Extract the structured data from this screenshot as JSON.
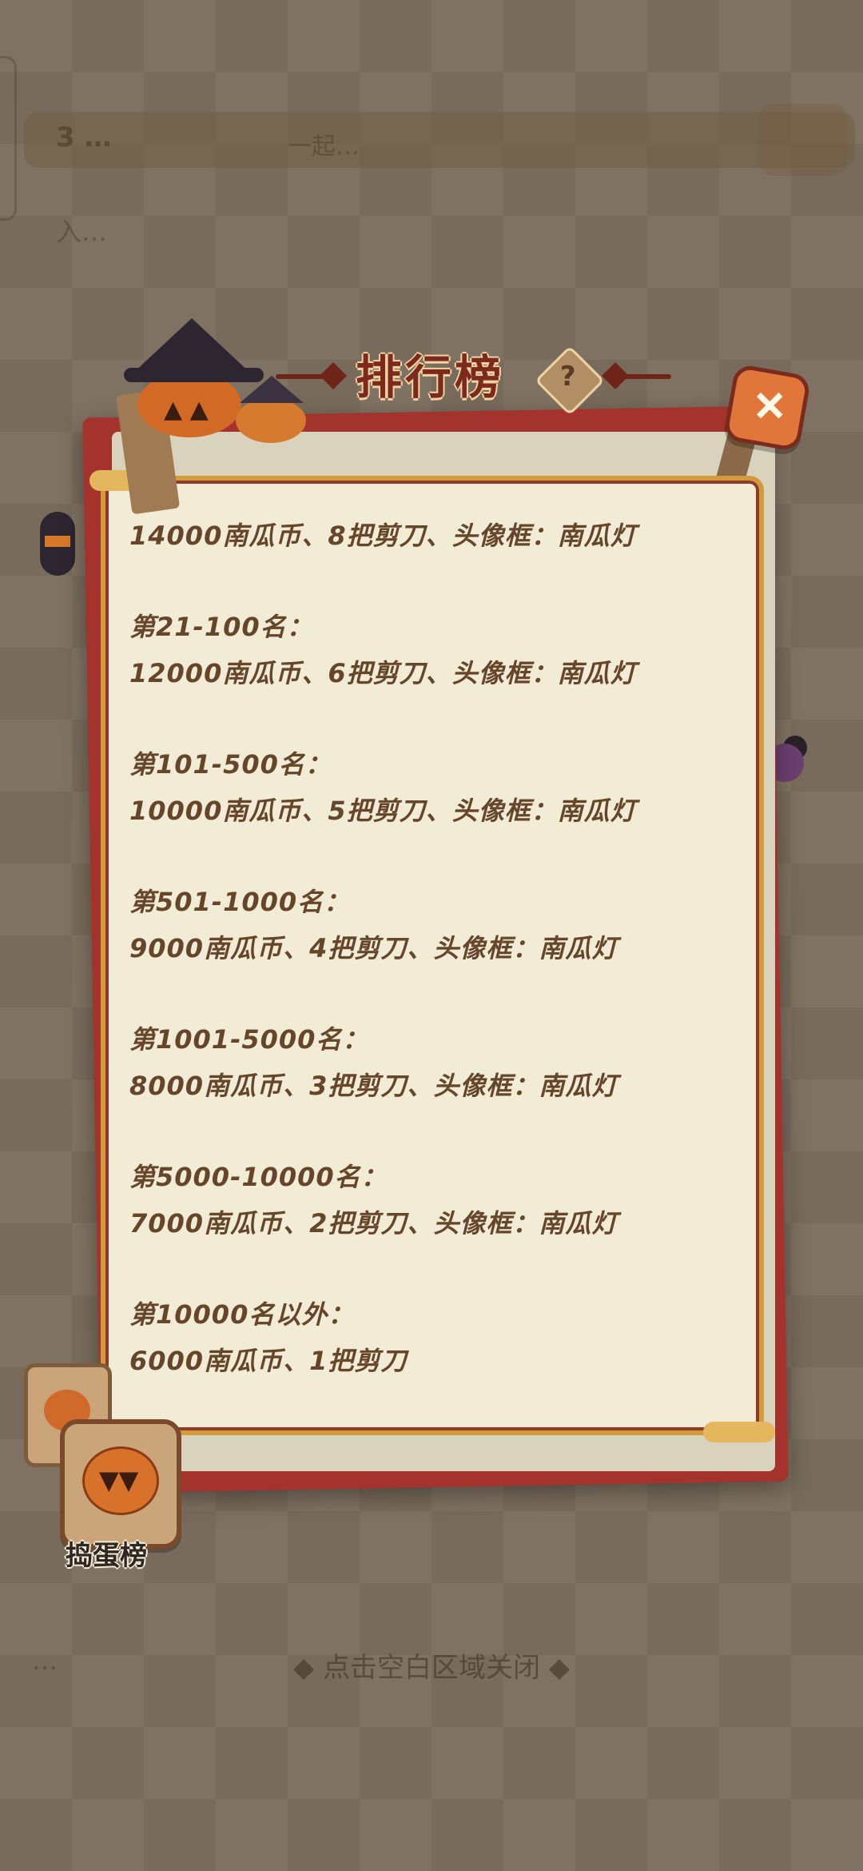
{
  "background": {
    "top_rank_text": "3 …",
    "top_slogan": "一起…",
    "join_text": "入…",
    "bottom_hint": "◆ 点击空白区域关闭 ◆",
    "bottom_left_text": "…"
  },
  "dialog": {
    "title": "排行榜",
    "help_symbol": "?",
    "close_symbol": "+",
    "rewards": [
      {
        "rank": "",
        "reward": "14000南瓜币、8把剪刀、头像框：南瓜灯"
      },
      {
        "rank": "第21-100名：",
        "reward": "12000南瓜币、6把剪刀、头像框：南瓜灯"
      },
      {
        "rank": "第101-500名：",
        "reward": "10000南瓜币、5把剪刀、头像框：南瓜灯"
      },
      {
        "rank": "第501-1000名：",
        "reward": "9000南瓜币、4把剪刀、头像框：南瓜灯"
      },
      {
        "rank": "第1001-5000名：",
        "reward": "8000南瓜币、3把剪刀、头像框：南瓜灯"
      },
      {
        "rank": "第5000-10000名：",
        "reward": "7000南瓜币、2把剪刀、头像框：南瓜灯"
      },
      {
        "rank": "第10000名以外：",
        "reward": "6000南瓜币、1把剪刀"
      }
    ]
  },
  "badge": {
    "label": "捣蛋榜",
    "face": "▼▼"
  },
  "colors": {
    "panel_bg": "#f2ecd7",
    "panel_border": "#d49b3a",
    "book_red": "#a3332c",
    "text_brown": "#66462b",
    "title_red": "#7b2a1d",
    "close_orange": "#e0763a"
  }
}
